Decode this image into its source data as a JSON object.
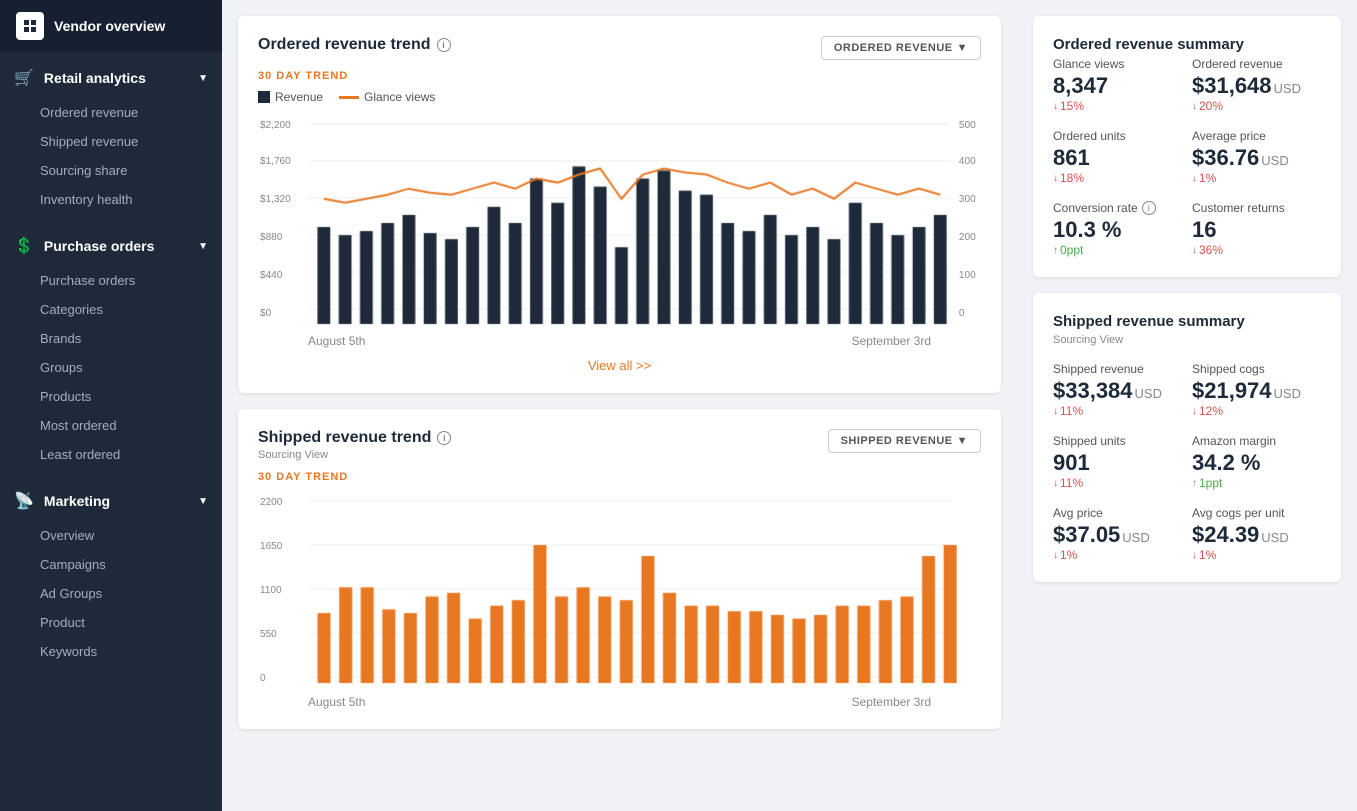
{
  "app": {
    "title": "Vendor overview",
    "logo": "V"
  },
  "sidebar": {
    "sections": [
      {
        "id": "retail-analytics",
        "label": "Retail analytics",
        "icon": "🛒",
        "expanded": true,
        "items": [
          {
            "id": "ordered-revenue",
            "label": "Ordered revenue",
            "active": false
          },
          {
            "id": "shipped-revenue",
            "label": "Shipped revenue",
            "active": false
          },
          {
            "id": "sourcing-share",
            "label": "Sourcing share",
            "active": false
          },
          {
            "id": "inventory-health",
            "label": "Inventory health",
            "active": false
          }
        ]
      },
      {
        "id": "purchase-orders",
        "label": "Purchase orders",
        "icon": "💲",
        "expanded": true,
        "items": [
          {
            "id": "purchase-orders-item",
            "label": "Purchase orders",
            "active": false
          },
          {
            "id": "categories",
            "label": "Categories",
            "active": false
          },
          {
            "id": "brands",
            "label": "Brands",
            "active": false
          },
          {
            "id": "groups",
            "label": "Groups",
            "active": false
          },
          {
            "id": "products",
            "label": "Products",
            "active": false
          },
          {
            "id": "most-ordered",
            "label": "Most ordered",
            "active": false
          },
          {
            "id": "least-ordered",
            "label": "Least ordered",
            "active": false
          }
        ]
      },
      {
        "id": "marketing",
        "label": "Marketing",
        "icon": "📡",
        "expanded": true,
        "items": [
          {
            "id": "overview",
            "label": "Overview",
            "active": false
          },
          {
            "id": "campaigns",
            "label": "Campaigns",
            "active": false
          },
          {
            "id": "ad-groups",
            "label": "Ad Groups",
            "active": false
          },
          {
            "id": "product-mkt",
            "label": "Product",
            "active": false
          },
          {
            "id": "keywords",
            "label": "Keywords",
            "active": false
          }
        ]
      }
    ]
  },
  "ordered_revenue_chart": {
    "title": "Ordered revenue trend",
    "trend_label": "30 DAY TREND",
    "button_label": "ORDERED REVENUE",
    "legend_revenue": "Revenue",
    "legend_glance": "Glance views",
    "start_date": "August 5th",
    "end_date": "September 3rd",
    "view_all": "View all >>",
    "y_labels_left": [
      "$2,200",
      "$1,760",
      "$1,320",
      "$880",
      "$440",
      "$0"
    ],
    "y_labels_right": [
      "500",
      "400",
      "300",
      "200",
      "100",
      "0"
    ],
    "bars": [
      55,
      50,
      52,
      55,
      58,
      50,
      48,
      52,
      60,
      55,
      75,
      62,
      80,
      72,
      45,
      75,
      78,
      70,
      68,
      55,
      52,
      58,
      50,
      52,
      48,
      65,
      55,
      50,
      52,
      58
    ],
    "line": [
      60,
      58,
      60,
      62,
      65,
      63,
      62,
      65,
      68,
      65,
      70,
      68,
      72,
      75,
      60,
      72,
      75,
      73,
      72,
      68,
      65,
      68,
      62,
      65,
      60,
      68,
      65,
      62,
      65,
      62
    ]
  },
  "ordered_revenue_summary": {
    "title": "Ordered revenue summary",
    "metrics": [
      {
        "id": "glance-views",
        "label": "Glance views",
        "value": "8,347",
        "usd": "",
        "change": "15%",
        "direction": "down",
        "info": false
      },
      {
        "id": "ordered-revenue",
        "label": "Ordered revenue",
        "value": "$31,648",
        "usd": "USD",
        "change": "20%",
        "direction": "down",
        "info": false
      },
      {
        "id": "ordered-units",
        "label": "Ordered units",
        "value": "861",
        "usd": "",
        "change": "18%",
        "direction": "down",
        "info": false
      },
      {
        "id": "average-price",
        "label": "Average price",
        "value": "$36.76",
        "usd": "USD",
        "change": "1%",
        "direction": "down",
        "info": false
      },
      {
        "id": "conversion-rate",
        "label": "Conversion rate",
        "value": "10.3 %",
        "usd": "",
        "change": "0ppt",
        "direction": "up",
        "info": true
      },
      {
        "id": "customer-returns",
        "label": "Customer returns",
        "value": "16",
        "usd": "",
        "change": "36%",
        "direction": "down",
        "info": false
      }
    ]
  },
  "shipped_revenue_chart": {
    "title": "Shipped revenue trend",
    "subtitle": "Sourcing View",
    "trend_label": "30 DAY TREND",
    "button_label": "SHIPPED REVENUE",
    "start_date": "August 5th",
    "end_date": "September 3rd",
    "y_labels": [
      "2200",
      "1650",
      "1100",
      "550",
      "0"
    ],
    "bars": [
      40,
      55,
      55,
      43,
      40,
      50,
      52,
      38,
      45,
      48,
      78,
      50,
      55,
      50,
      48,
      72,
      52,
      45,
      45,
      42,
      42,
      40,
      38,
      40,
      45,
      45,
      48,
      50,
      72,
      78
    ]
  },
  "shipped_revenue_summary": {
    "title": "Shipped revenue summary",
    "subtitle": "Sourcing View",
    "metrics": [
      {
        "id": "shipped-revenue",
        "label": "Shipped revenue",
        "value": "$33,384",
        "usd": "USD",
        "change": "11%",
        "direction": "down"
      },
      {
        "id": "shipped-cogs",
        "label": "Shipped cogs",
        "value": "$21,974",
        "usd": "USD",
        "change": "12%",
        "direction": "down"
      },
      {
        "id": "shipped-units",
        "label": "Shipped units",
        "value": "901",
        "usd": "",
        "change": "11%",
        "direction": "down"
      },
      {
        "id": "amazon-margin",
        "label": "Amazon margin",
        "value": "34.2 %",
        "usd": "",
        "change": "1ppt",
        "direction": "up"
      },
      {
        "id": "avg-price",
        "label": "Avg price",
        "value": "$37.05",
        "usd": "USD",
        "change": "1%",
        "direction": "down"
      },
      {
        "id": "avg-cogs-per-unit",
        "label": "Avg cogs per unit",
        "value": "$24.39",
        "usd": "USD",
        "change": "1%",
        "direction": "down"
      }
    ]
  }
}
